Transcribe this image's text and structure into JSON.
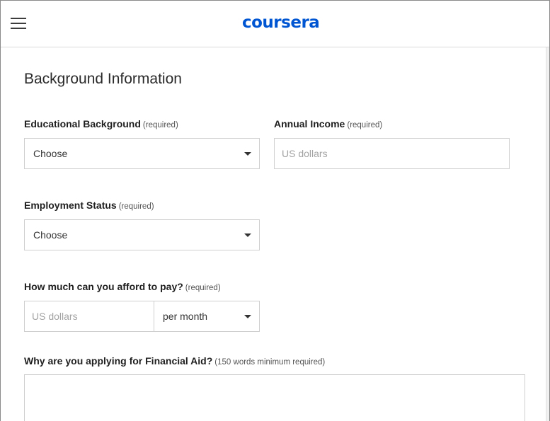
{
  "header": {
    "logo_text": "coursera",
    "menu_icon": "hamburger-menu-icon",
    "brand_color": "#0056d2"
  },
  "form": {
    "section_title": "Background Information",
    "educational_background": {
      "label": "Educational Background",
      "required": "(required)",
      "value": "Choose"
    },
    "annual_income": {
      "label": "Annual Income",
      "required": "(required)",
      "placeholder": "US dollars"
    },
    "employment_status": {
      "label": "Employment Status",
      "required": "(required)",
      "value": "Choose"
    },
    "afford_to_pay": {
      "label": "How much can you afford to pay?",
      "required": "(required)",
      "placeholder": "US dollars",
      "period_value": "per month"
    },
    "why_applying": {
      "label": "Why are you applying for Financial Aid?",
      "required": "(150 words minimum required)"
    }
  }
}
